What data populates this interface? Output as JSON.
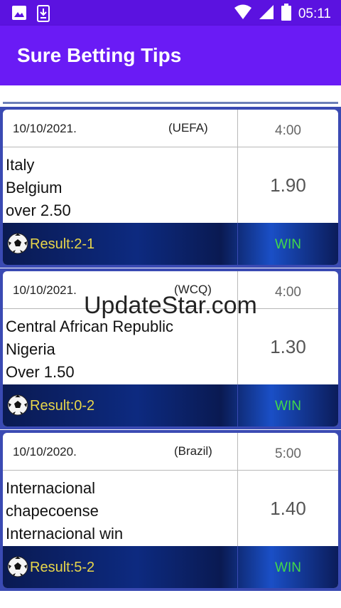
{
  "status_bar": {
    "time": "05:11"
  },
  "app": {
    "title": "Sure Betting Tips"
  },
  "watermark": "UpdateStar.com",
  "tips": [
    {
      "date": "10/10/2021.",
      "league": "(UEFA)",
      "time": "4:00",
      "lines": [
        "Italy",
        "Belgium",
        "over 2.50"
      ],
      "odds": "1.90",
      "result": "Result:2-1",
      "outcome": "WIN"
    },
    {
      "date": "10/10/2021.",
      "league": "(WCQ)",
      "time": "4:00",
      "lines": [
        "Central African Republic",
        "Nigeria",
        "Over 1.50"
      ],
      "odds": "1.30",
      "result": "Result:0-2",
      "outcome": "WIN"
    },
    {
      "date": "10/10/2020.",
      "league": "(Brazil)",
      "time": "5:00",
      "lines": [
        "Internacional",
        "chapecoense",
        "Internacional win"
      ],
      "odds": "1.40",
      "result": "Result:5-2",
      "outcome": "WIN"
    }
  ]
}
